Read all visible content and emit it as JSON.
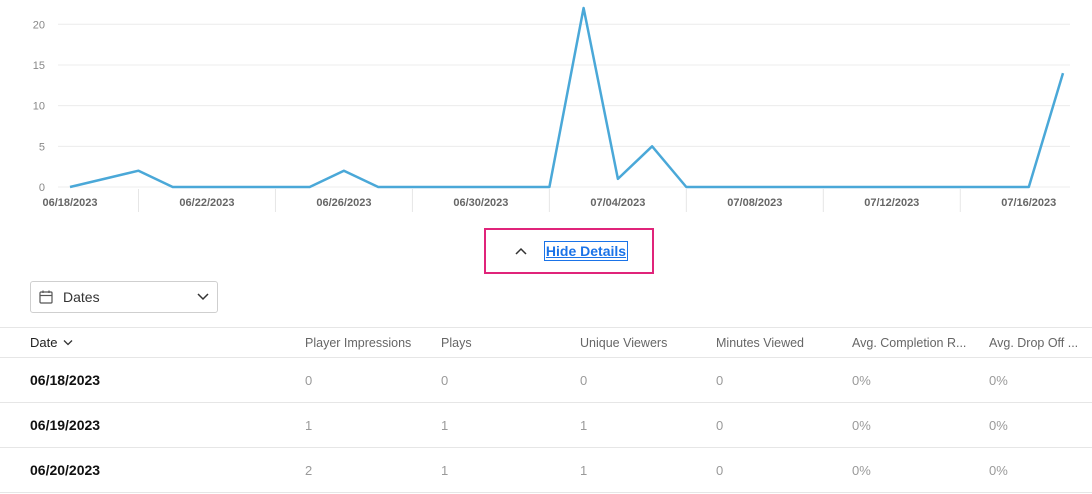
{
  "chart_data": {
    "type": "line",
    "x": [
      "06/18/2023",
      "06/19/2023",
      "06/20/2023",
      "06/21/2023",
      "06/22/2023",
      "06/23/2023",
      "06/24/2023",
      "06/25/2023",
      "06/26/2023",
      "06/27/2023",
      "06/28/2023",
      "06/29/2023",
      "06/30/2023",
      "07/01/2023",
      "07/02/2023",
      "07/03/2023",
      "07/04/2023",
      "07/05/2023",
      "07/06/2023",
      "07/07/2023",
      "07/08/2023",
      "07/09/2023",
      "07/10/2023",
      "07/11/2023",
      "07/12/2023",
      "07/13/2023",
      "07/14/2023",
      "07/15/2023",
      "07/16/2023",
      "07/17/2023"
    ],
    "series": [
      {
        "values": [
          0,
          1,
          2,
          0,
          0,
          0,
          0,
          0,
          2,
          0,
          0,
          0,
          0,
          0,
          0,
          22,
          1,
          5,
          0,
          0,
          0,
          0,
          0,
          0,
          0,
          0,
          0,
          0,
          0,
          14
        ]
      }
    ],
    "x_tick_labels": [
      "06/18/2023",
      "06/22/2023",
      "06/26/2023",
      "06/30/2023",
      "07/04/2023",
      "07/08/2023",
      "07/12/2023",
      "07/16/2023"
    ],
    "y_ticks": [
      0,
      5,
      10,
      15,
      20
    ],
    "ylim": [
      0,
      22
    ],
    "grid": true,
    "line_color": "#4aa8d8"
  },
  "toggle": {
    "label": "Hide Details",
    "icon": "chevron-up-icon"
  },
  "filter": {
    "label": "Dates",
    "icon": "calendar-icon"
  },
  "table": {
    "columns": [
      "Date",
      "Player Impressions",
      "Plays",
      "Unique Viewers",
      "Minutes Viewed",
      "Avg. Completion R...",
      "Avg. Drop Off ..."
    ],
    "rows": [
      [
        "06/18/2023",
        "0",
        "0",
        "0",
        "0",
        "0%",
        "0%"
      ],
      [
        "06/19/2023",
        "1",
        "1",
        "1",
        "0",
        "0%",
        "0%"
      ],
      [
        "06/20/2023",
        "2",
        "1",
        "1",
        "0",
        "0%",
        "0%"
      ]
    ]
  }
}
